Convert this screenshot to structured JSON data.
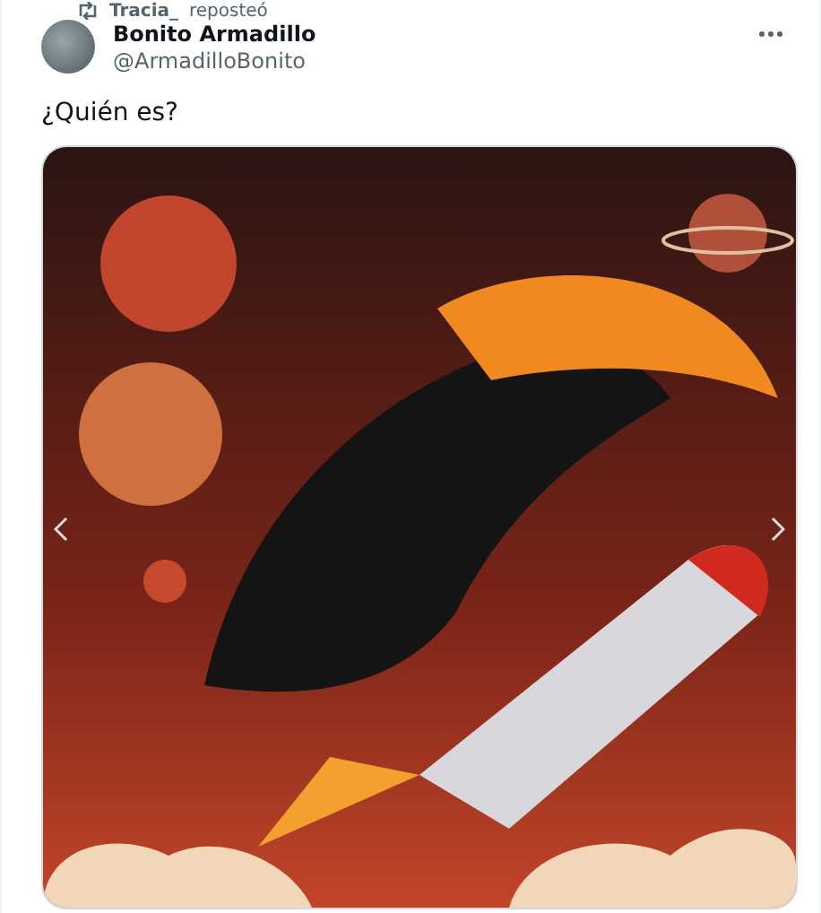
{
  "repost": {
    "user": "Tracia_",
    "action": "reposteó"
  },
  "tweet": {
    "name": "Bonito Armadillo",
    "handle": "@ArmadilloBonito",
    "text": "¿Quién es?"
  }
}
